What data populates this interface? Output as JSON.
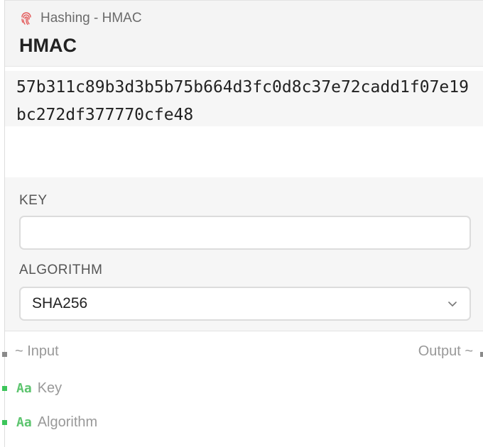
{
  "node": {
    "subtitle": "Hashing - HMAC",
    "title": "HMAC",
    "icon": "fingerprint-icon",
    "accent_color": "#e35b5b"
  },
  "output": {
    "value": "57b311c89b3d3b5b75b664d3fc0d8c37e72cadd1f07e19bc272df377770cfe48"
  },
  "settings": {
    "key_label": "KEY",
    "key_value": "",
    "algorithm_label": "ALGORITHM",
    "algorithm_value": "SHA256"
  },
  "io": {
    "input_label": "~ Input",
    "output_label": "Output ~"
  },
  "params": [
    {
      "type": "Aa",
      "label": "Key"
    },
    {
      "type": "Aa",
      "label": "Algorithm"
    }
  ],
  "colors": {
    "port_grey": "#8a8a8a",
    "port_green": "#3cc55a",
    "type_badge": "#5cc46e"
  }
}
